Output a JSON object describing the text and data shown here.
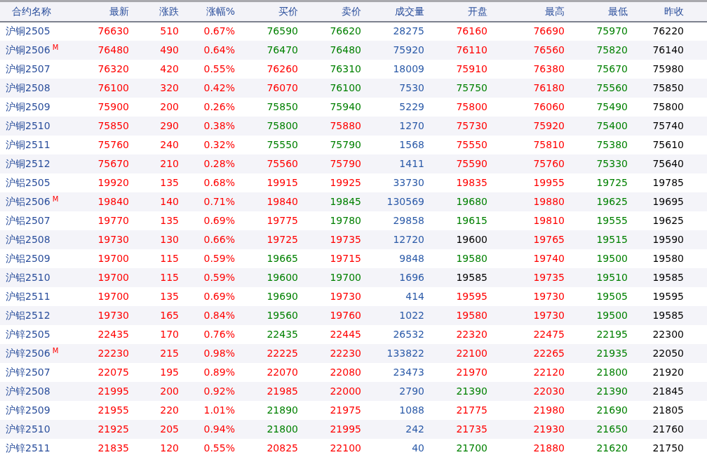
{
  "table": {
    "columns": [
      {
        "label": "合约名称",
        "kind": "name"
      },
      {
        "label": "最新",
        "kind": "price"
      },
      {
        "label": "涨跌",
        "kind": "price"
      },
      {
        "label": "涨幅%",
        "kind": "price"
      },
      {
        "label": "买价",
        "kind": "price"
      },
      {
        "label": "卖价",
        "kind": "price"
      },
      {
        "label": "成交量",
        "kind": "volume"
      },
      {
        "label": "开盘",
        "kind": "price"
      },
      {
        "label": "最高",
        "kind": "price"
      },
      {
        "label": "最低",
        "kind": "price"
      },
      {
        "label": "昨收",
        "kind": "close"
      }
    ],
    "rows": [
      {
        "cells": [
          {
            "text": "沪铜2505"
          },
          {
            "text": "76630",
            "color": "#ff0000"
          },
          {
            "text": "510",
            "color": "#ff0000"
          },
          {
            "text": "0.67%",
            "color": "#ff0000"
          },
          {
            "text": "76590",
            "color": "#008000"
          },
          {
            "text": "76620",
            "color": "#008000"
          },
          {
            "text": "28275"
          },
          {
            "text": "76160",
            "color": "#ff0000"
          },
          {
            "text": "76690",
            "color": "#ff0000"
          },
          {
            "text": "75970",
            "color": "#008000"
          },
          {
            "text": "76220"
          }
        ]
      },
      {
        "cells": [
          {
            "text": "沪铜2506",
            "tag": "M"
          },
          {
            "text": "76480",
            "color": "#ff0000"
          },
          {
            "text": "490",
            "color": "#ff0000"
          },
          {
            "text": "0.64%",
            "color": "#ff0000"
          },
          {
            "text": "76470",
            "color": "#008000"
          },
          {
            "text": "76480",
            "color": "#008000"
          },
          {
            "text": "75920"
          },
          {
            "text": "76110",
            "color": "#ff0000"
          },
          {
            "text": "76560",
            "color": "#ff0000"
          },
          {
            "text": "75820",
            "color": "#008000"
          },
          {
            "text": "76140"
          }
        ]
      },
      {
        "cells": [
          {
            "text": "沪铜2507"
          },
          {
            "text": "76320",
            "color": "#ff0000"
          },
          {
            "text": "420",
            "color": "#ff0000"
          },
          {
            "text": "0.55%",
            "color": "#ff0000"
          },
          {
            "text": "76260",
            "color": "#ff0000"
          },
          {
            "text": "76310",
            "color": "#008000"
          },
          {
            "text": "18009"
          },
          {
            "text": "75910",
            "color": "#ff0000"
          },
          {
            "text": "76380",
            "color": "#ff0000"
          },
          {
            "text": "75670",
            "color": "#008000"
          },
          {
            "text": "75980"
          }
        ]
      },
      {
        "cells": [
          {
            "text": "沪铜2508"
          },
          {
            "text": "76100",
            "color": "#ff0000"
          },
          {
            "text": "320",
            "color": "#ff0000"
          },
          {
            "text": "0.42%",
            "color": "#ff0000"
          },
          {
            "text": "76070",
            "color": "#ff0000"
          },
          {
            "text": "76100",
            "color": "#008000"
          },
          {
            "text": "7530"
          },
          {
            "text": "75750",
            "color": "#008000"
          },
          {
            "text": "76180",
            "color": "#ff0000"
          },
          {
            "text": "75560",
            "color": "#008000"
          },
          {
            "text": "75850"
          }
        ]
      },
      {
        "cells": [
          {
            "text": "沪铜2509"
          },
          {
            "text": "75900",
            "color": "#ff0000"
          },
          {
            "text": "200",
            "color": "#ff0000"
          },
          {
            "text": "0.26%",
            "color": "#ff0000"
          },
          {
            "text": "75850",
            "color": "#008000"
          },
          {
            "text": "75940",
            "color": "#008000"
          },
          {
            "text": "5229"
          },
          {
            "text": "75800",
            "color": "#ff0000"
          },
          {
            "text": "76060",
            "color": "#ff0000"
          },
          {
            "text": "75490",
            "color": "#008000"
          },
          {
            "text": "75800"
          }
        ]
      },
      {
        "cells": [
          {
            "text": "沪铜2510"
          },
          {
            "text": "75850",
            "color": "#ff0000"
          },
          {
            "text": "290",
            "color": "#ff0000"
          },
          {
            "text": "0.38%",
            "color": "#ff0000"
          },
          {
            "text": "75800",
            "color": "#008000"
          },
          {
            "text": "75880",
            "color": "#ff0000"
          },
          {
            "text": "1270"
          },
          {
            "text": "75730",
            "color": "#ff0000"
          },
          {
            "text": "75920",
            "color": "#ff0000"
          },
          {
            "text": "75400",
            "color": "#008000"
          },
          {
            "text": "75740"
          }
        ]
      },
      {
        "cells": [
          {
            "text": "沪铜2511"
          },
          {
            "text": "75760",
            "color": "#ff0000"
          },
          {
            "text": "240",
            "color": "#ff0000"
          },
          {
            "text": "0.32%",
            "color": "#ff0000"
          },
          {
            "text": "75550",
            "color": "#008000"
          },
          {
            "text": "75790",
            "color": "#008000"
          },
          {
            "text": "1568"
          },
          {
            "text": "75550",
            "color": "#ff0000"
          },
          {
            "text": "75810",
            "color": "#ff0000"
          },
          {
            "text": "75380",
            "color": "#008000"
          },
          {
            "text": "75610"
          }
        ]
      },
      {
        "cells": [
          {
            "text": "沪铜2512"
          },
          {
            "text": "75670",
            "color": "#ff0000"
          },
          {
            "text": "210",
            "color": "#ff0000"
          },
          {
            "text": "0.28%",
            "color": "#ff0000"
          },
          {
            "text": "75560",
            "color": "#ff0000"
          },
          {
            "text": "75790",
            "color": "#ff0000"
          },
          {
            "text": "1411"
          },
          {
            "text": "75590",
            "color": "#ff0000"
          },
          {
            "text": "75760",
            "color": "#ff0000"
          },
          {
            "text": "75330",
            "color": "#008000"
          },
          {
            "text": "75640"
          }
        ]
      },
      {
        "cells": [
          {
            "text": "沪铝2505"
          },
          {
            "text": "19920",
            "color": "#ff0000"
          },
          {
            "text": "135",
            "color": "#ff0000"
          },
          {
            "text": "0.68%",
            "color": "#ff0000"
          },
          {
            "text": "19915",
            "color": "#ff0000"
          },
          {
            "text": "19925",
            "color": "#ff0000"
          },
          {
            "text": "33730"
          },
          {
            "text": "19835",
            "color": "#ff0000"
          },
          {
            "text": "19955",
            "color": "#ff0000"
          },
          {
            "text": "19725",
            "color": "#008000"
          },
          {
            "text": "19785"
          }
        ]
      },
      {
        "cells": [
          {
            "text": "沪铝2506",
            "tag": "M"
          },
          {
            "text": "19840",
            "color": "#ff0000"
          },
          {
            "text": "140",
            "color": "#ff0000"
          },
          {
            "text": "0.71%",
            "color": "#ff0000"
          },
          {
            "text": "19840",
            "color": "#ff0000"
          },
          {
            "text": "19845",
            "color": "#008000"
          },
          {
            "text": "130569"
          },
          {
            "text": "19680",
            "color": "#008000"
          },
          {
            "text": "19880",
            "color": "#ff0000"
          },
          {
            "text": "19625",
            "color": "#008000"
          },
          {
            "text": "19695"
          }
        ]
      },
      {
        "cells": [
          {
            "text": "沪铝2507"
          },
          {
            "text": "19770",
            "color": "#ff0000"
          },
          {
            "text": "135",
            "color": "#ff0000"
          },
          {
            "text": "0.69%",
            "color": "#ff0000"
          },
          {
            "text": "19775",
            "color": "#ff0000"
          },
          {
            "text": "19780",
            "color": "#008000"
          },
          {
            "text": "29858"
          },
          {
            "text": "19615",
            "color": "#008000"
          },
          {
            "text": "19810",
            "color": "#ff0000"
          },
          {
            "text": "19555",
            "color": "#008000"
          },
          {
            "text": "19625"
          }
        ]
      },
      {
        "cells": [
          {
            "text": "沪铝2508"
          },
          {
            "text": "19730",
            "color": "#ff0000"
          },
          {
            "text": "130",
            "color": "#ff0000"
          },
          {
            "text": "0.66%",
            "color": "#ff0000"
          },
          {
            "text": "19725",
            "color": "#ff0000"
          },
          {
            "text": "19735",
            "color": "#ff0000"
          },
          {
            "text": "12720"
          },
          {
            "text": "19600",
            "color": "#000000"
          },
          {
            "text": "19765",
            "color": "#ff0000"
          },
          {
            "text": "19515",
            "color": "#008000"
          },
          {
            "text": "19590"
          }
        ]
      },
      {
        "cells": [
          {
            "text": "沪铝2509"
          },
          {
            "text": "19700",
            "color": "#ff0000"
          },
          {
            "text": "115",
            "color": "#ff0000"
          },
          {
            "text": "0.59%",
            "color": "#ff0000"
          },
          {
            "text": "19665",
            "color": "#008000"
          },
          {
            "text": "19715",
            "color": "#ff0000"
          },
          {
            "text": "9848"
          },
          {
            "text": "19580",
            "color": "#008000"
          },
          {
            "text": "19740",
            "color": "#ff0000"
          },
          {
            "text": "19500",
            "color": "#008000"
          },
          {
            "text": "19580"
          }
        ]
      },
      {
        "cells": [
          {
            "text": "沪铝2510"
          },
          {
            "text": "19700",
            "color": "#ff0000"
          },
          {
            "text": "115",
            "color": "#ff0000"
          },
          {
            "text": "0.59%",
            "color": "#ff0000"
          },
          {
            "text": "19600",
            "color": "#008000"
          },
          {
            "text": "19700",
            "color": "#008000"
          },
          {
            "text": "1696"
          },
          {
            "text": "19585",
            "color": "#000000"
          },
          {
            "text": "19735",
            "color": "#ff0000"
          },
          {
            "text": "19510",
            "color": "#008000"
          },
          {
            "text": "19585"
          }
        ]
      },
      {
        "cells": [
          {
            "text": "沪铝2511"
          },
          {
            "text": "19700",
            "color": "#ff0000"
          },
          {
            "text": "135",
            "color": "#ff0000"
          },
          {
            "text": "0.69%",
            "color": "#ff0000"
          },
          {
            "text": "19690",
            "color": "#008000"
          },
          {
            "text": "19730",
            "color": "#ff0000"
          },
          {
            "text": "414"
          },
          {
            "text": "19595",
            "color": "#ff0000"
          },
          {
            "text": "19730",
            "color": "#ff0000"
          },
          {
            "text": "19505",
            "color": "#008000"
          },
          {
            "text": "19595"
          }
        ]
      },
      {
        "cells": [
          {
            "text": "沪铝2512"
          },
          {
            "text": "19730",
            "color": "#ff0000"
          },
          {
            "text": "165",
            "color": "#ff0000"
          },
          {
            "text": "0.84%",
            "color": "#ff0000"
          },
          {
            "text": "19560",
            "color": "#008000"
          },
          {
            "text": "19760",
            "color": "#ff0000"
          },
          {
            "text": "1022"
          },
          {
            "text": "19580",
            "color": "#ff0000"
          },
          {
            "text": "19730",
            "color": "#ff0000"
          },
          {
            "text": "19500",
            "color": "#008000"
          },
          {
            "text": "19585"
          }
        ]
      },
      {
        "cells": [
          {
            "text": "沪锌2505"
          },
          {
            "text": "22435",
            "color": "#ff0000"
          },
          {
            "text": "170",
            "color": "#ff0000"
          },
          {
            "text": "0.76%",
            "color": "#ff0000"
          },
          {
            "text": "22435",
            "color": "#008000"
          },
          {
            "text": "22445",
            "color": "#ff0000"
          },
          {
            "text": "26532"
          },
          {
            "text": "22320",
            "color": "#ff0000"
          },
          {
            "text": "22475",
            "color": "#ff0000"
          },
          {
            "text": "22195",
            "color": "#008000"
          },
          {
            "text": "22300"
          }
        ]
      },
      {
        "cells": [
          {
            "text": "沪锌2506",
            "tag": "M"
          },
          {
            "text": "22230",
            "color": "#ff0000"
          },
          {
            "text": "215",
            "color": "#ff0000"
          },
          {
            "text": "0.98%",
            "color": "#ff0000"
          },
          {
            "text": "22225",
            "color": "#ff0000"
          },
          {
            "text": "22230",
            "color": "#ff0000"
          },
          {
            "text": "133822"
          },
          {
            "text": "22100",
            "color": "#ff0000"
          },
          {
            "text": "22265",
            "color": "#ff0000"
          },
          {
            "text": "21935",
            "color": "#008000"
          },
          {
            "text": "22050"
          }
        ]
      },
      {
        "cells": [
          {
            "text": "沪锌2507"
          },
          {
            "text": "22075",
            "color": "#ff0000"
          },
          {
            "text": "195",
            "color": "#ff0000"
          },
          {
            "text": "0.89%",
            "color": "#ff0000"
          },
          {
            "text": "22070",
            "color": "#ff0000"
          },
          {
            "text": "22080",
            "color": "#ff0000"
          },
          {
            "text": "23473"
          },
          {
            "text": "21970",
            "color": "#ff0000"
          },
          {
            "text": "22120",
            "color": "#ff0000"
          },
          {
            "text": "21800",
            "color": "#008000"
          },
          {
            "text": "21920"
          }
        ]
      },
      {
        "cells": [
          {
            "text": "沪锌2508"
          },
          {
            "text": "21995",
            "color": "#ff0000"
          },
          {
            "text": "200",
            "color": "#ff0000"
          },
          {
            "text": "0.92%",
            "color": "#ff0000"
          },
          {
            "text": "21985",
            "color": "#ff0000"
          },
          {
            "text": "22000",
            "color": "#ff0000"
          },
          {
            "text": "2790"
          },
          {
            "text": "21390",
            "color": "#008000"
          },
          {
            "text": "22030",
            "color": "#ff0000"
          },
          {
            "text": "21390",
            "color": "#008000"
          },
          {
            "text": "21845"
          }
        ]
      },
      {
        "cells": [
          {
            "text": "沪锌2509"
          },
          {
            "text": "21955",
            "color": "#ff0000"
          },
          {
            "text": "220",
            "color": "#ff0000"
          },
          {
            "text": "1.01%",
            "color": "#ff0000"
          },
          {
            "text": "21890",
            "color": "#008000"
          },
          {
            "text": "21975",
            "color": "#ff0000"
          },
          {
            "text": "1088"
          },
          {
            "text": "21775",
            "color": "#ff0000"
          },
          {
            "text": "21980",
            "color": "#ff0000"
          },
          {
            "text": "21690",
            "color": "#008000"
          },
          {
            "text": "21805"
          }
        ]
      },
      {
        "cells": [
          {
            "text": "沪锌2510"
          },
          {
            "text": "21925",
            "color": "#ff0000"
          },
          {
            "text": "205",
            "color": "#ff0000"
          },
          {
            "text": "0.94%",
            "color": "#ff0000"
          },
          {
            "text": "21800",
            "color": "#008000"
          },
          {
            "text": "21995",
            "color": "#ff0000"
          },
          {
            "text": "242"
          },
          {
            "text": "21735",
            "color": "#ff0000"
          },
          {
            "text": "21930",
            "color": "#ff0000"
          },
          {
            "text": "21650",
            "color": "#008000"
          },
          {
            "text": "21760"
          }
        ]
      },
      {
        "cells": [
          {
            "text": "沪锌2511"
          },
          {
            "text": "21835",
            "color": "#ff0000"
          },
          {
            "text": "120",
            "color": "#ff0000"
          },
          {
            "text": "0.55%",
            "color": "#ff0000"
          },
          {
            "text": "20825",
            "color": "#ff0000"
          },
          {
            "text": "22100",
            "color": "#ff0000"
          },
          {
            "text": "40"
          },
          {
            "text": "21700",
            "color": "#008000"
          },
          {
            "text": "21880",
            "color": "#ff0000"
          },
          {
            "text": "21620",
            "color": "#008000"
          },
          {
            "text": "21750"
          }
        ]
      }
    ]
  }
}
